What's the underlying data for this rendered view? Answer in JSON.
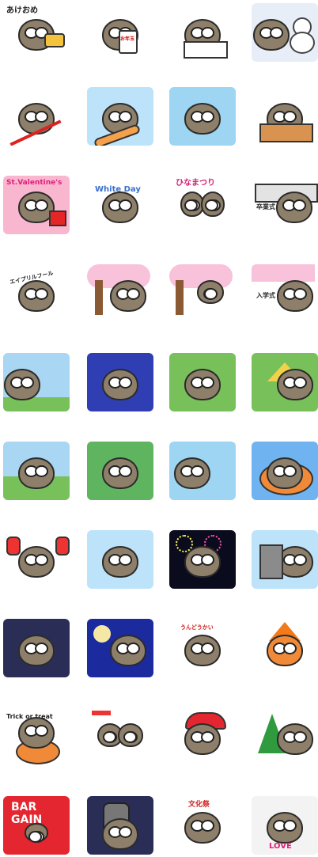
{
  "sticker_labels": {
    "r0c0": "あけおめ",
    "r0c1": "お年玉",
    "r2c0": "St.Valentine's",
    "r2c1": "White Day",
    "r2c2": "ひなまつり",
    "r2c3": "卒業式",
    "r3c0": "エイプリルフール",
    "r3c3": "入学式",
    "r7c2": "うんどうかい",
    "r8c0": "Trick or treat",
    "r9c0": "BAR GAIN",
    "r9c2": "文化祭",
    "r9c3": "LOVE"
  },
  "colors": {
    "sky_blue": "#a9d7f3",
    "pink": "#f7a8c8",
    "night": "#0b0b1e",
    "grass": "#78c15a"
  },
  "icons": {
    "owl": "owl-mascot",
    "cherry-blossom": "sakura",
    "snowman": "snowman",
    "christmas-tree": "xmas-tree"
  }
}
